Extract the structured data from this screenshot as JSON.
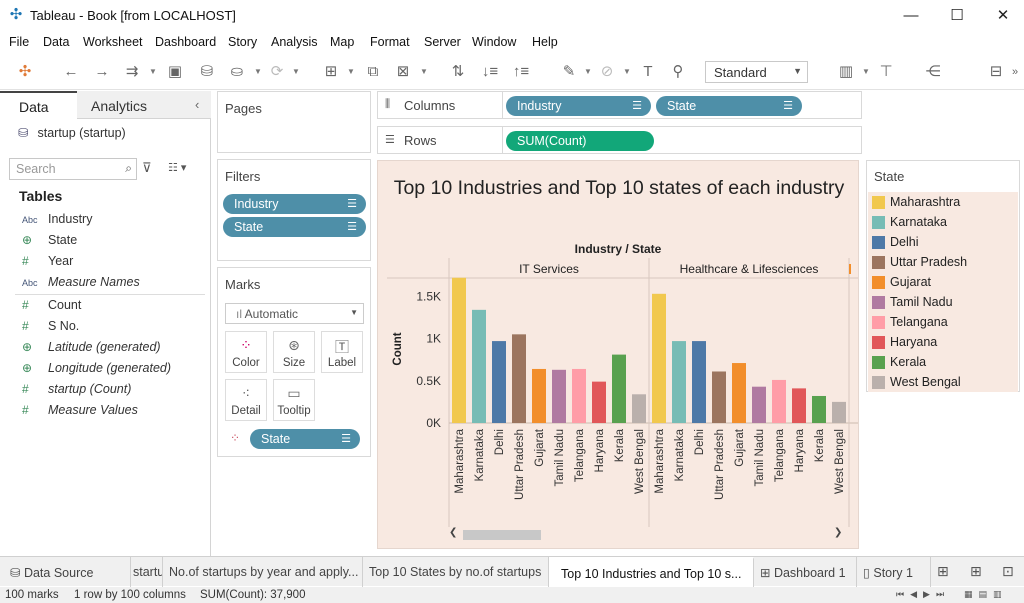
{
  "window": {
    "title": "Tableau - Book [from LOCALHOST]",
    "min": "—",
    "max": "☐",
    "close": "✕"
  },
  "menu": [
    "File",
    "Data",
    "Worksheet",
    "Dashboard",
    "Story",
    "Analysis",
    "Map",
    "Format",
    "Server",
    "Window",
    "Help"
  ],
  "toolbar": {
    "fit": "Standard"
  },
  "datapane": {
    "tab_data": "Data",
    "tab_analytics": "Analytics",
    "datasource": "startup (startup)",
    "search_placeholder": "Search",
    "tables_heading": "Tables",
    "fields": [
      {
        "type": "Abc",
        "name": "Industry"
      },
      {
        "type": "globe",
        "name": "State"
      },
      {
        "type": "#",
        "name": "Year"
      },
      {
        "type": "Abc",
        "name": "Measure Names"
      },
      {
        "type": "#",
        "name": "Count"
      },
      {
        "type": "#",
        "name": "S No."
      },
      {
        "type": "globe",
        "name": "Latitude (generated)"
      },
      {
        "type": "globe",
        "name": "Longitude (generated)"
      },
      {
        "type": "#",
        "name": "startup (Count)"
      },
      {
        "type": "#",
        "name": "Measure Values"
      }
    ]
  },
  "shelves": {
    "pages": "Pages",
    "filters": "Filters",
    "filter_pills": [
      "Industry",
      "State"
    ],
    "marks": "Marks",
    "mark_type": "Automatic",
    "mark_buttons": [
      "Color",
      "Size",
      "Label",
      "Detail",
      "Tooltip"
    ],
    "mark_pill": "State",
    "columns_label": "Columns",
    "columns_pills": [
      "Industry",
      "State"
    ],
    "rows_label": "Rows",
    "rows_pills": [
      "SUM(Count)"
    ]
  },
  "legend": {
    "title": "State",
    "items": [
      {
        "name": "Maharashtra",
        "color": "#f1c84e"
      },
      {
        "name": "Karnataka",
        "color": "#77bcb5"
      },
      {
        "name": "Delhi",
        "color": "#4e79a7"
      },
      {
        "name": "Uttar Pradesh",
        "color": "#9c755f"
      },
      {
        "name": "Gujarat",
        "color": "#f28e2b"
      },
      {
        "name": "Tamil Nadu",
        "color": "#b07aa1"
      },
      {
        "name": "Telangana",
        "color": "#ff9da7"
      },
      {
        "name": "Haryana",
        "color": "#e15759"
      },
      {
        "name": "Kerala",
        "color": "#59a14f"
      },
      {
        "name": "West Bengal",
        "color": "#bab0ac"
      }
    ]
  },
  "chart_data": {
    "type": "bar",
    "title": "Top 10 Industries and Top 10 states of each industry",
    "header": "Industry / State",
    "ylabel": "Count",
    "yticks": [
      "0K",
      "0.5K",
      "1K",
      "1.5K"
    ],
    "ylim": [
      0,
      1800
    ],
    "panes": [
      {
        "name": "IT Services",
        "categories": [
          "Maharashtra",
          "Karnataka",
          "Delhi",
          "Uttar Pradesh",
          "Gujarat",
          "Tamil Nadu",
          "Telangana",
          "Haryana",
          "Kerala",
          "West Bengal"
        ],
        "values": [
          1720,
          1340,
          970,
          1050,
          640,
          630,
          640,
          490,
          810,
          340
        ]
      },
      {
        "name": "Healthcare & Lifesciences",
        "categories": [
          "Maharashtra",
          "Karnataka",
          "Delhi",
          "Uttar Pradesh",
          "Gujarat",
          "Tamil Nadu",
          "Telangana",
          "Haryana",
          "Kerala",
          "West Bengal"
        ],
        "values": [
          1530,
          970,
          970,
          610,
          710,
          430,
          510,
          410,
          320,
          250
        ]
      }
    ]
  },
  "tabs": {
    "datasource": "Data Source",
    "tab2": "startu...",
    "tab3": "No.of startups by year and apply...",
    "tab4": "Top 10 States by no.of startups",
    "tab5": "Top 10  Industries and Top 10 s...",
    "tab6": "Dashboard 1",
    "tab7": "Story 1"
  },
  "status": {
    "marks": "100 marks",
    "rows": "1 row by 100 columns",
    "sum": "SUM(Count): 37,900"
  }
}
